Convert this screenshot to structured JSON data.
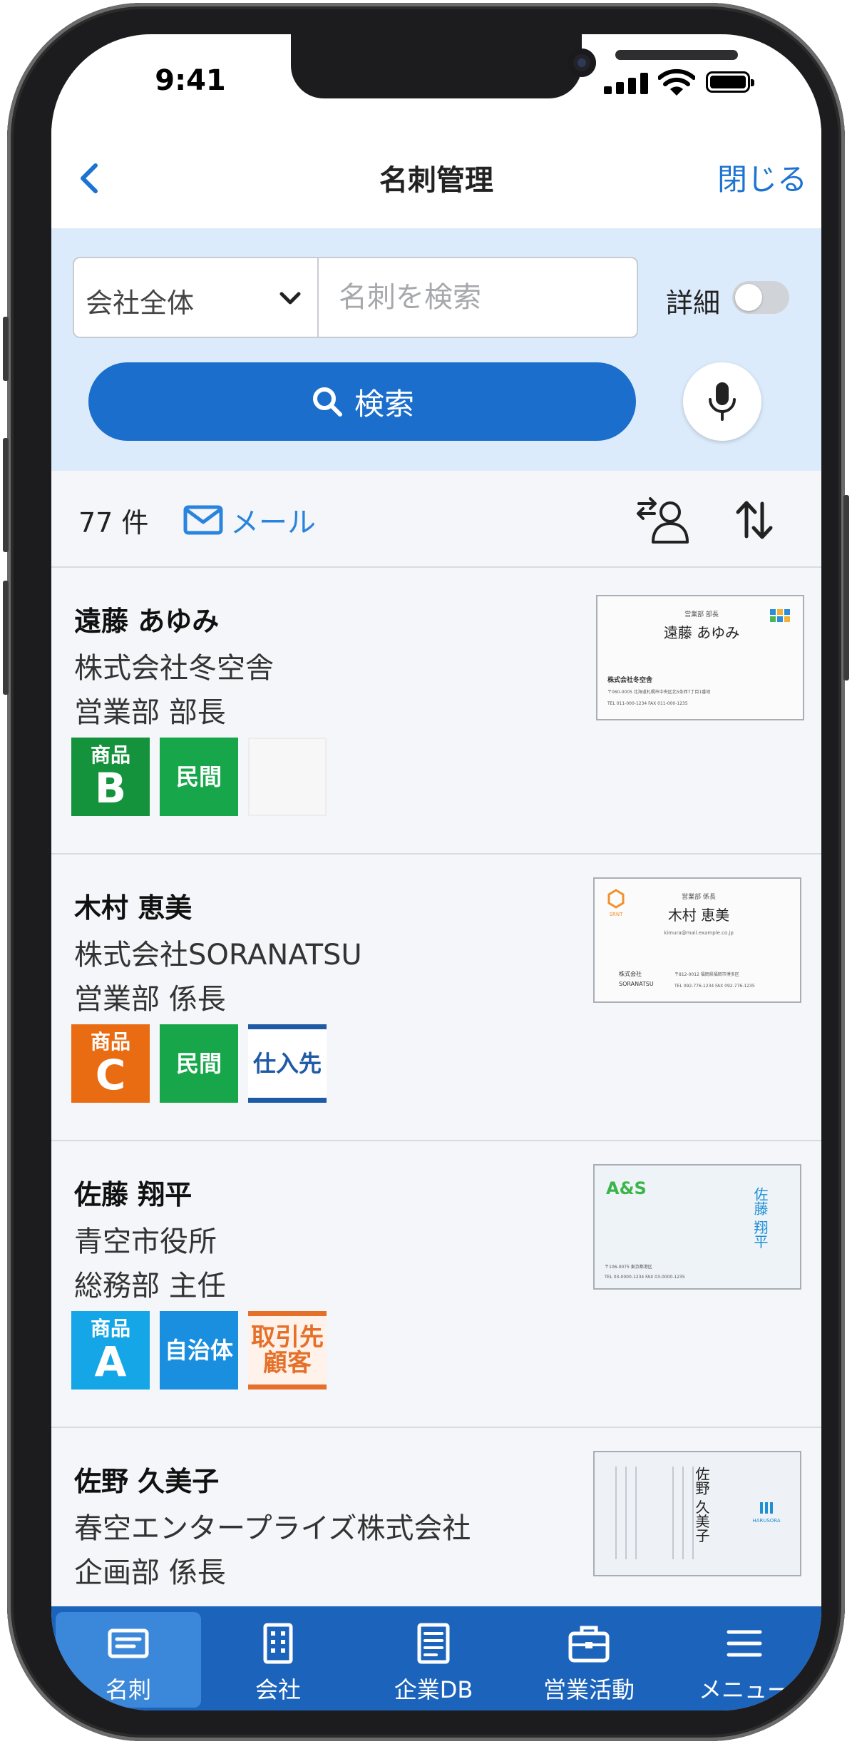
{
  "status_bar": {
    "time": "9:41"
  },
  "nav": {
    "title": "名刺管理",
    "close_label": "閉じる"
  },
  "search": {
    "scope_value": "会社全体",
    "placeholder": "名刺を検索",
    "detail_label": "詳細",
    "detail_enabled": false,
    "search_button_label": "検索"
  },
  "results": {
    "count_text": "77 件",
    "mail_label": "メール"
  },
  "cards": [
    {
      "name": "遠藤 あゆみ",
      "company": "株式会社冬空舎",
      "title": "営業部 部長",
      "tags": [
        {
          "kind": "product",
          "top": "商品",
          "big": "B",
          "color": "#14923c"
        },
        {
          "kind": "label",
          "text": "民間",
          "color": "#17a64a"
        },
        {
          "kind": "empty"
        }
      ],
      "thumb": {
        "dept": "営業部 部長",
        "name": "遠藤 あゆみ",
        "company": "株式会社冬空舎",
        "address": "〒060-0005 北海道札幌市中央区北5条西7丁目1番地",
        "contact": "TEL 011-000-1234 FAX 011-000-1235"
      }
    },
    {
      "name": "木村 恵美",
      "company": "株式会社SORANATSU",
      "title": "営業部 係長",
      "tags": [
        {
          "kind": "product",
          "top": "商品",
          "big": "C",
          "color": "#ea6c12"
        },
        {
          "kind": "label",
          "text": "民間",
          "color": "#17a64a"
        },
        {
          "kind": "supplier",
          "text": "仕入先"
        }
      ],
      "thumb": {
        "logo": "SRNT",
        "dept": "営業部 係長",
        "name": "木村 恵美",
        "email": "kimura@mail.example.co.jp",
        "company_line1": "株式会社",
        "company_line2": "SORANATSU",
        "address": "〒812-0012 福岡県福岡市博多区",
        "contact": "TEL 092-776-1234 FAX 092-776-1235"
      }
    },
    {
      "name": "佐藤 翔平",
      "company": "青空市役所",
      "title": "総務部 主任",
      "tags": [
        {
          "kind": "product",
          "top": "商品",
          "big": "A",
          "color": "#14a6e6"
        },
        {
          "kind": "label",
          "text": "自治体",
          "color": "#1a8fe0"
        },
        {
          "kind": "torihiki",
          "line1": "取引先",
          "line2": "顧客"
        }
      ],
      "thumb": {
        "logo": "A&S",
        "name_vertical": "佐藤 翔平",
        "address": "〒106-0075 東京都港区",
        "contact": "TEL 03-0000-1234 FAX 03-0000-1235"
      }
    },
    {
      "name": "佐野 久美子",
      "company": "春空エンタープライズ株式会社",
      "title": "企画部 係長",
      "tags": [],
      "thumb": {
        "name_vertical": "佐野 久美子",
        "logo": "HARUSORA"
      }
    }
  ],
  "tab_bar": {
    "tabs": [
      {
        "label": "名刺",
        "icon": "card-icon",
        "active": true
      },
      {
        "label": "会社",
        "icon": "building-icon",
        "active": false
      },
      {
        "label": "企業DB",
        "icon": "database-icon",
        "active": false
      },
      {
        "label": "営業活動",
        "icon": "briefcase-icon",
        "active": false
      },
      {
        "label": "メニュー",
        "icon": "menu-icon",
        "active": false
      }
    ]
  },
  "colors": {
    "accent": "#1b6ecb",
    "link": "#1d73d1",
    "search_panel_bg": "#dcebfb",
    "tab_bar_bg": "#1b63bb",
    "list_bg": "#f4f6f9"
  }
}
